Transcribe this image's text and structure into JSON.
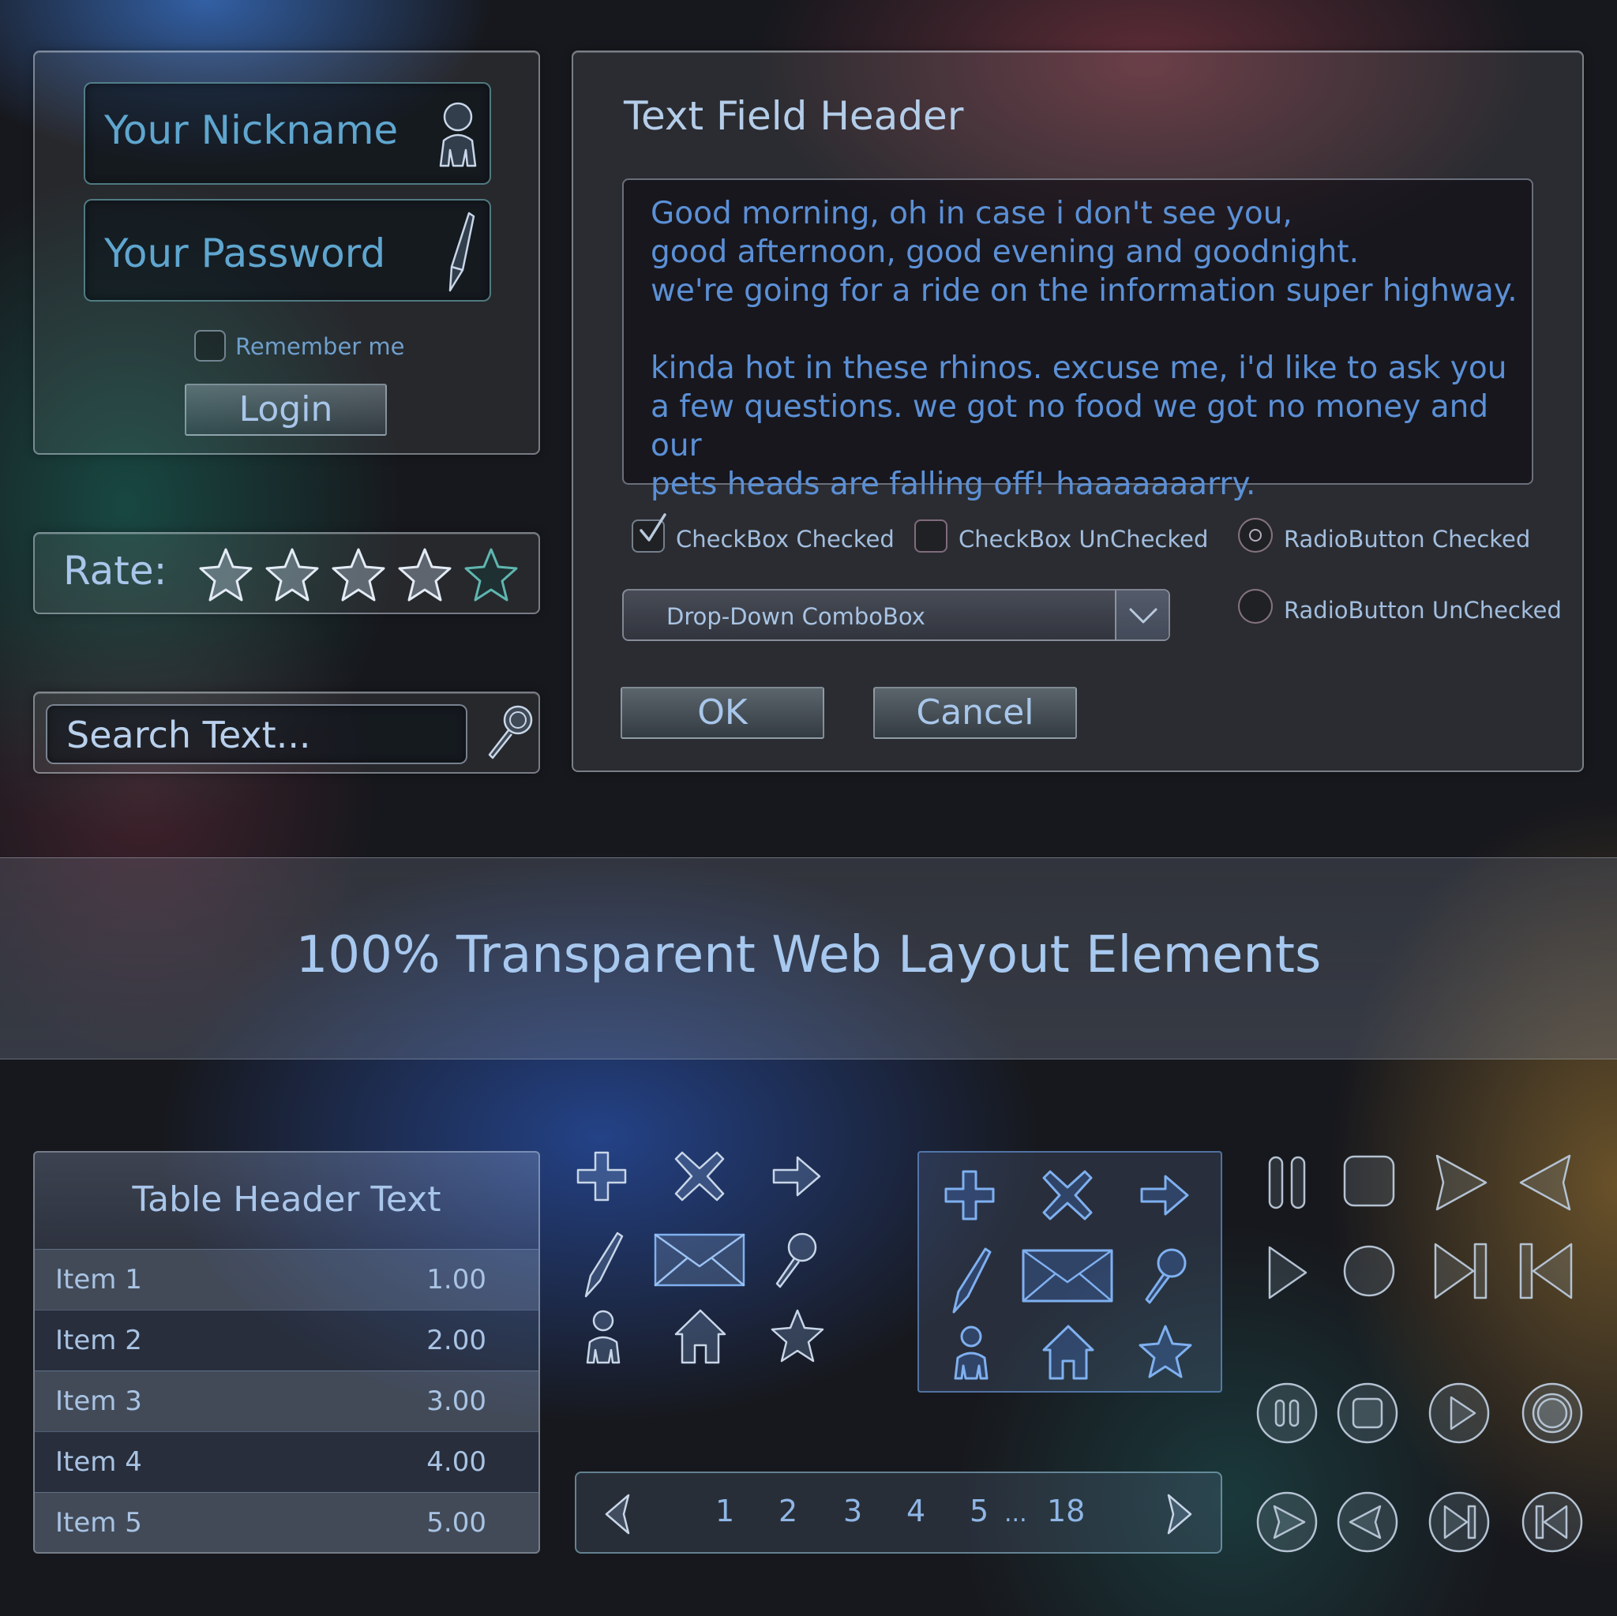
{
  "login": {
    "nickname_placeholder": "Your Nickname",
    "password_placeholder": "Your Password",
    "remember_label": "Remember me",
    "login_label": "Login"
  },
  "rate": {
    "label": "Rate:",
    "stars_total": 5,
    "stars_filled": 4
  },
  "search": {
    "placeholder": "Search Text..."
  },
  "dialog": {
    "header": "Text Field Header",
    "text_lines": [
      "Good morning, oh in case i don't see you,",
      "good afternoon, good evening and goodnight.",
      "we're going for a ride on the information super highway.",
      "",
      "kinda hot in these rhinos. excuse me, i'd like to ask you",
      "a few questions. we got no food we got no money and our",
      "pets heads are falling off! haaaaaaarry."
    ],
    "checkbox_checked_label": "CheckBox Checked",
    "checkbox_unchecked_label": "CheckBox UnChecked",
    "radio_checked_label": "RadioButton Checked",
    "radio_unchecked_label": "RadioButton UnChecked",
    "combo_value": "Drop-Down ComboBox",
    "ok_label": "OK",
    "cancel_label": "Cancel"
  },
  "banner": {
    "title": "100% Transparent Web Layout Elements"
  },
  "table": {
    "header": "Table Header Text",
    "rows": [
      {
        "item": "Item 1",
        "value": "1.00"
      },
      {
        "item": "Item 2",
        "value": "2.00"
      },
      {
        "item": "Item 3",
        "value": "3.00"
      },
      {
        "item": "Item 4",
        "value": "4.00"
      },
      {
        "item": "Item 5",
        "value": "5.00"
      }
    ]
  },
  "icons": [
    "plus-icon",
    "close-icon",
    "arrow-right-icon",
    "pen-icon",
    "envelope-icon",
    "magnifier-icon",
    "user-icon",
    "home-icon",
    "star-icon"
  ],
  "pagination": {
    "pages": [
      "1",
      "2",
      "3",
      "4",
      "5"
    ],
    "ellipsis": "...",
    "last": "18"
  },
  "media_icons": [
    "pause-icon",
    "stop-icon",
    "forward-icon",
    "back-icon",
    "play-icon",
    "record-icon",
    "skip-next-icon",
    "skip-prev-icon"
  ],
  "colors": {
    "text_blue": "#8fb4e0",
    "accent_teal": "#82c8d2",
    "icon_blue": "#7fb0f0"
  }
}
